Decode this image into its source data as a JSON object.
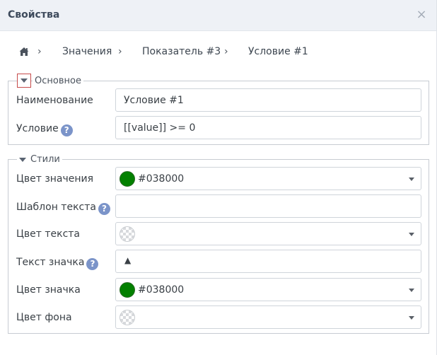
{
  "dialog": {
    "title": "Свойства",
    "close_glyph": "×"
  },
  "breadcrumb": {
    "home_icon": "home-icon",
    "separator": "›",
    "items": [
      "Значения",
      "Показатель #3",
      "Условие #1"
    ]
  },
  "main_group": {
    "legend": "Основное",
    "name_label": "Наименование",
    "name_value": "Условие #1",
    "condition_label": "Условие",
    "condition_value": "[[value]] >= 0"
  },
  "styles_group": {
    "legend": "Стили",
    "value_color_label": "Цвет значения",
    "value_color": "#038000",
    "value_color_text": "#038000",
    "text_template_label": "Шаблон текста",
    "text_template_value": "",
    "text_color_label": "Цвет текста",
    "badge_text_label": "Текст значка",
    "badge_text_value": "▲",
    "badge_color_label": "Цвет значка",
    "badge_color": "#038000",
    "badge_color_text": "#038000",
    "bg_color_label": "Цвет фона"
  },
  "help_glyph": "?"
}
